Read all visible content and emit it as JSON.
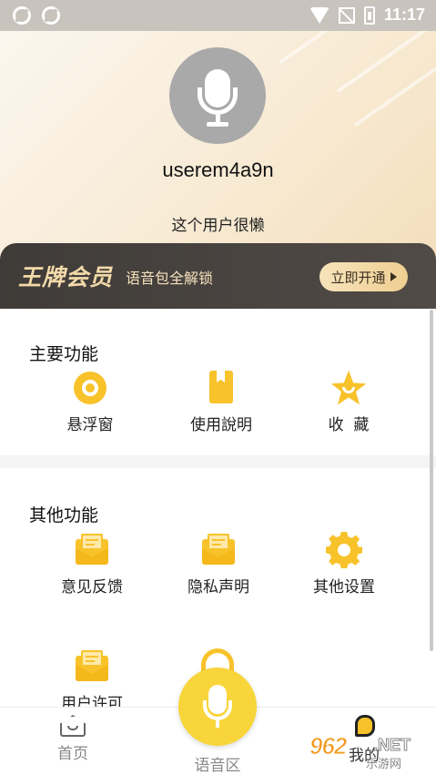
{
  "status_bar": {
    "time": "11:17"
  },
  "profile": {
    "username": "userem4a9n",
    "bio": "这个用户很懒"
  },
  "vip": {
    "title": "王牌会员",
    "subtitle": "语音包全解锁",
    "button_label": "立即开通"
  },
  "main_features": {
    "title": "主要功能",
    "items": [
      {
        "label": "悬浮窗",
        "icon": "float-window-icon"
      },
      {
        "label": "使用說明",
        "icon": "book-icon"
      },
      {
        "label": "收  藏",
        "icon": "star-icon"
      }
    ]
  },
  "other_features": {
    "title": "其他功能",
    "items": [
      {
        "label": "意见反馈",
        "icon": "mail-icon"
      },
      {
        "label": "隐私声明",
        "icon": "mail-icon"
      },
      {
        "label": "其他设置",
        "icon": "gear-icon"
      },
      {
        "label": "用户许可",
        "icon": "mail-icon"
      }
    ]
  },
  "tabbar": {
    "items": [
      {
        "label": "首页",
        "icon": "home-icon"
      },
      {
        "label": "语音区",
        "icon": "mic-icon"
      },
      {
        "label": "我的",
        "icon": "profile-icon"
      }
    ]
  },
  "watermark": {
    "number": "962",
    "suffix": ".NET",
    "caption": "乐游网"
  },
  "colors": {
    "accent": "#f8c22a",
    "vip_bg": "#45403c",
    "vip_gold": "#f2d9a8"
  }
}
